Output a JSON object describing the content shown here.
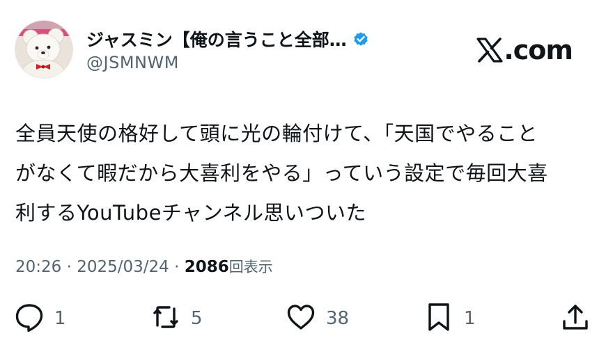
{
  "profile": {
    "display_name": "ジャスミン【俺の言うこと全部…",
    "handle": "@JSMNWM",
    "verified_badge_icon": "verified-check-icon",
    "avatar": "teddy-bear-avatar"
  },
  "brand": {
    "logo_icon": "x-logo-icon",
    "suffix": ".com"
  },
  "tweet": {
    "lines": [
      "全員天使の格好して頭に光の輪付けて、「天国でやること",
      "がなくて暇だから大喜利をやる」っていう設定で毎回大喜",
      "利するYouTubeチャンネル思いついた"
    ]
  },
  "meta": {
    "time": "20:26",
    "separator": "·",
    "date": "2025/03/24",
    "views_count": "2086",
    "views_label": "回表示"
  },
  "actions": {
    "reply": {
      "icon": "reply-icon",
      "count": "1"
    },
    "retweet": {
      "icon": "retweet-icon",
      "count": "5"
    },
    "like": {
      "icon": "heart-icon",
      "count": "38"
    },
    "bookmark": {
      "icon": "bookmark-icon",
      "count": "1"
    },
    "share": {
      "icon": "share-icon"
    }
  },
  "colors": {
    "text_primary": "#0f1419",
    "text_secondary": "#536471",
    "verified_blue": "#1d9bf0",
    "background": "#ffffff"
  }
}
